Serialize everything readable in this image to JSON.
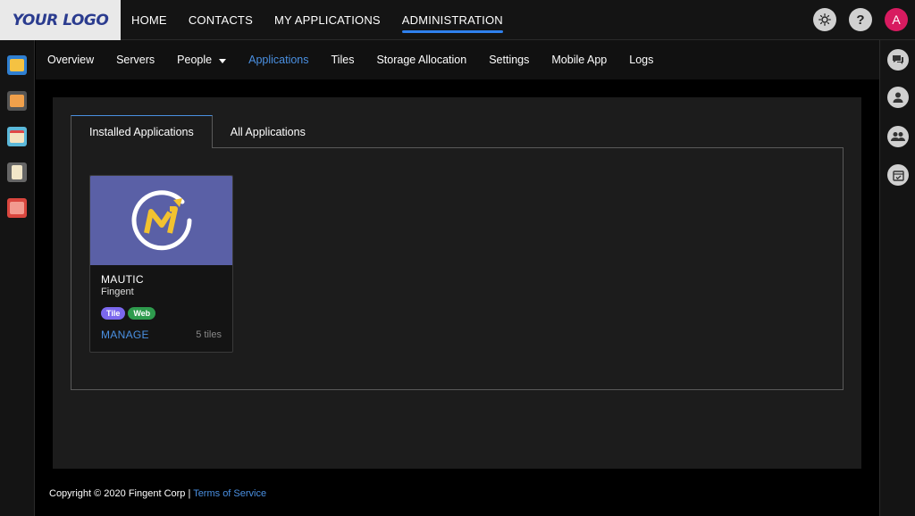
{
  "logo": {
    "text": "YOUR LOGO"
  },
  "topnav": {
    "items": [
      {
        "label": "HOME"
      },
      {
        "label": "CONTACTS"
      },
      {
        "label": "MY APPLICATIONS"
      },
      {
        "label": "ADMINISTRATION",
        "active": true
      }
    ],
    "help_label": "?",
    "avatar_letter": "A"
  },
  "subnav": {
    "items": [
      {
        "label": "Overview"
      },
      {
        "label": "Servers"
      },
      {
        "label": "People",
        "dropdown": true
      },
      {
        "label": "Applications",
        "active": true
      },
      {
        "label": "Tiles"
      },
      {
        "label": "Storage Allocation"
      },
      {
        "label": "Settings"
      },
      {
        "label": "Mobile App"
      },
      {
        "label": "Logs"
      }
    ]
  },
  "tabs": {
    "installed": "Installed Applications",
    "all": "All Applications"
  },
  "app_card": {
    "name": "MAUTIC",
    "vendor": "Fingent",
    "badges": [
      "Tile",
      "Web"
    ],
    "manage_label": "MANAGE",
    "tiles_count": "5  tiles",
    "image_color": "#5a60a6"
  },
  "footer": {
    "copyright": "Copyright © 2020 Fingent Corp |",
    "terms_label": "Terms of Service"
  },
  "colors": {
    "accent": "#4a90e2",
    "avatar": "#d81b60",
    "tile_badge": "#7b68ee",
    "web_badge": "#2e9b4d"
  },
  "left_icons": [
    "folder-icon",
    "inbox-icon",
    "calendar-icon",
    "clipboard-icon",
    "photos-icon"
  ],
  "right_icons": [
    "chat-icon",
    "user-icon",
    "group-icon",
    "calendar-check-icon"
  ]
}
